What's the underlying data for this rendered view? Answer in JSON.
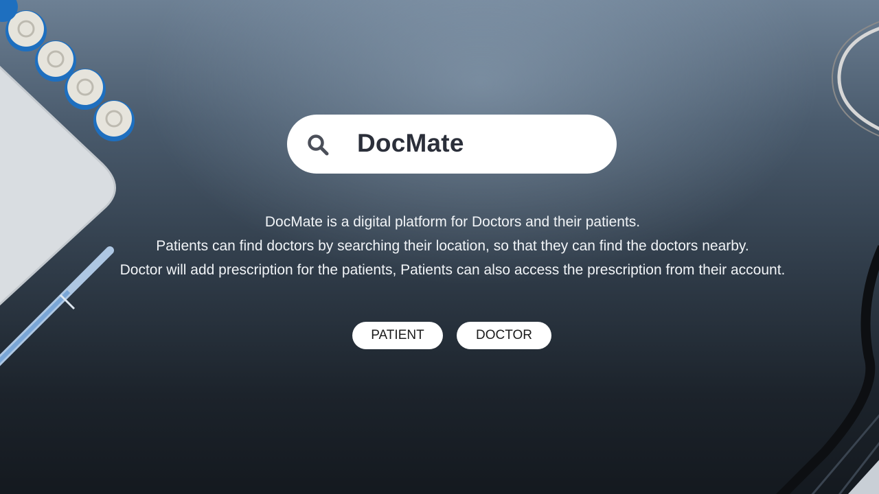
{
  "search": {
    "icon": "search-icon",
    "brand": "DocMate"
  },
  "description": {
    "lines": [
      "DocMate is a digital platform for Doctors and their patients.",
      "Patients can find doctors by searching their location, so that they can find the doctors nearby.",
      "Doctor will add prescription for the patients, Patients can also access the prescription from their account."
    ]
  },
  "actions": {
    "patient_label": "PATIENT",
    "doctor_label": "DOCTOR"
  },
  "colors": {
    "button_bg": "#ffffff",
    "title_text": "#2b2f3a",
    "description_text": "#f1f4f7"
  }
}
